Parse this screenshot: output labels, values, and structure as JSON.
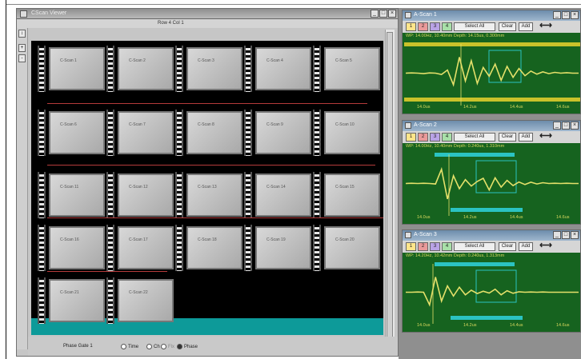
{
  "viewer": {
    "title": "CScan Viewer",
    "subtitle": "Row 4 Col 1",
    "win_min": "_",
    "win_max": "□",
    "win_close": "×",
    "left_buttons": [
      "↕",
      "+",
      "-"
    ],
    "bottom_status": "Phase Gate 1",
    "radio_options": [
      "Time",
      "Ch",
      "Flx",
      "Phase"
    ],
    "tiles": [
      {
        "row": 0,
        "col": 0,
        "label": "C-Scan 1"
      },
      {
        "row": 0,
        "col": 1,
        "label": "C-Scan 2"
      },
      {
        "row": 0,
        "col": 2,
        "label": "C-Scan 3"
      },
      {
        "row": 0,
        "col": 3,
        "label": "C-Scan 4"
      },
      {
        "row": 0,
        "col": 4,
        "label": "C-Scan 5"
      },
      {
        "row": 1,
        "col": 0,
        "label": "C-Scan 6"
      },
      {
        "row": 1,
        "col": 1,
        "label": "C-Scan 7"
      },
      {
        "row": 1,
        "col": 2,
        "label": "C-Scan 8"
      },
      {
        "row": 1,
        "col": 3,
        "label": "C-Scan 9"
      },
      {
        "row": 1,
        "col": 4,
        "label": "C-Scan 10"
      },
      {
        "row": 2,
        "col": 0,
        "label": "C-Scan 11"
      },
      {
        "row": 2,
        "col": 1,
        "label": "C-Scan 12"
      },
      {
        "row": 2,
        "col": 2,
        "label": "C-Scan 13"
      },
      {
        "row": 2,
        "col": 3,
        "label": "C-Scan 14"
      },
      {
        "row": 2,
        "col": 4,
        "label": "C-Scan 15"
      },
      {
        "row": 3,
        "col": 0,
        "label": "C-Scan 16"
      },
      {
        "row": 3,
        "col": 1,
        "label": "C-Scan 17"
      },
      {
        "row": 3,
        "col": 2,
        "label": "C-Scan 18"
      },
      {
        "row": 3,
        "col": 3,
        "label": "C-Scan 19"
      },
      {
        "row": 3,
        "col": 4,
        "label": "C-Scan 20"
      },
      {
        "row": 4,
        "col": 0,
        "label": "C-Scan 21"
      },
      {
        "row": 4,
        "col": 1,
        "label": "C-Scan 22"
      }
    ]
  },
  "ascans": [
    {
      "title": "A-Scan 1",
      "channel_buttons": [
        "1",
        "2",
        "3",
        "4"
      ],
      "select_all": "Select All",
      "clear": "Clear",
      "add": "Add",
      "readout": "WP: 14.00Hz, 10.40mm   Depth: 14.15us, 0.300mm",
      "ticks": [
        "14.0us",
        "14.2us",
        "14.4us",
        "14.6us"
      ],
      "waveform": [
        0,
        0.01,
        0,
        -0.02,
        0.01,
        0,
        -0.05,
        0.12,
        -0.45,
        0.62,
        -0.3,
        0.48,
        -0.4,
        0.22,
        -0.12,
        0.35,
        -0.28,
        0.26,
        -0.16,
        0.18,
        -0.1,
        0.08,
        -0.04,
        0.05,
        -0.02,
        0.03,
        0,
        0.02,
        0,
        0
      ]
    },
    {
      "title": "A-Scan 2",
      "channel_buttons": [
        "1",
        "2",
        "3",
        "4"
      ],
      "select_all": "Select All",
      "clear": "Clear",
      "add": "Add",
      "readout": "WP: 14.00Hz, 10.40mm   Depth: 0.240us, 1.310mm",
      "ticks": [
        "14.0us",
        "14.2us",
        "14.4us",
        "14.6us"
      ],
      "waveform": [
        0,
        0.01,
        0,
        0.01,
        0,
        -0.02,
        0.55,
        -0.6,
        0.3,
        -0.2,
        0.15,
        -0.1,
        0.08,
        0.2,
        -0.25,
        0.22,
        -0.14,
        0.12,
        -0.08,
        0.06,
        -0.04,
        0.05,
        -0.02,
        0.03,
        0,
        0.01,
        0,
        0.01,
        0,
        0
      ]
    },
    {
      "title": "A-Scan 3",
      "channel_buttons": [
        "1",
        "2",
        "3",
        "4"
      ],
      "select_all": "Select All",
      "clear": "Clear",
      "add": "Add",
      "readout": "WP: 14.20Hz, 10.42mm   Depth: 0.240us, 1.313mm",
      "ticks": [
        "14.0us",
        "14.2us",
        "14.4us",
        "14.6us"
      ],
      "waveform": [
        0,
        0,
        0.01,
        0,
        -0.5,
        0.6,
        -0.35,
        0.25,
        -0.15,
        0.2,
        -0.1,
        0.08,
        -0.05,
        0.04,
        -0.03,
        0.12,
        -0.1,
        0.06,
        -0.04,
        0.02,
        0,
        0.01,
        0,
        0.01,
        0,
        0,
        0,
        0,
        0,
        0
      ]
    }
  ],
  "colors": {
    "chart_bg": "#16631f",
    "waveform": "#e4e06a",
    "gate": "#2bc3c2",
    "teal": "#0d9a99",
    "channel_colors": [
      "#ffe58a",
      "#e99a9a",
      "#b9a3e6",
      "#a8e0a8"
    ]
  }
}
